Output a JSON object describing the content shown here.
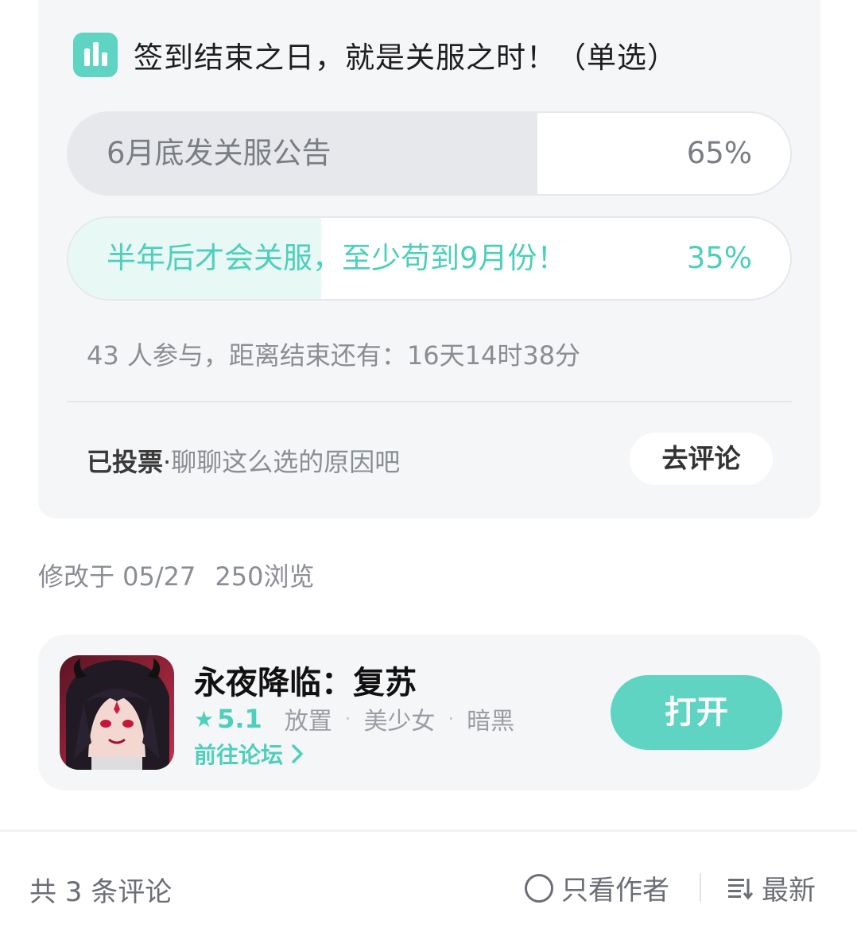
{
  "poll": {
    "title": "签到结束之日，就是关服之时！（单选）",
    "options": [
      {
        "label": "6月底发关服公告",
        "percent_label": "65%",
        "percent": 65
      },
      {
        "label": "半年后才会关服，至少苟到9月份！",
        "percent_label": "35%",
        "percent": 35
      }
    ],
    "meta": "43 人参与，距离结束还有：16天14时38分",
    "voted_label": "已投票",
    "voted_dot": "·",
    "voted_hint": "聊聊这么选的原因吧",
    "comment_button": "去评论"
  },
  "post": {
    "modified": "修改于 05/27",
    "views": "250浏览"
  },
  "game": {
    "name": "永夜降临：复苏",
    "rating": "5.1",
    "tags": [
      "放置",
      "美少女",
      "暗黑"
    ],
    "forum_link": "前往论坛",
    "open_button": "打开"
  },
  "comments": {
    "count": "共 3 条评论",
    "author_only": "只看作者",
    "sort": "最新"
  },
  "colors": {
    "accent": "#5fd4c2",
    "accent_text": "#4ecfbb",
    "card_bg": "#f5f6f8"
  }
}
